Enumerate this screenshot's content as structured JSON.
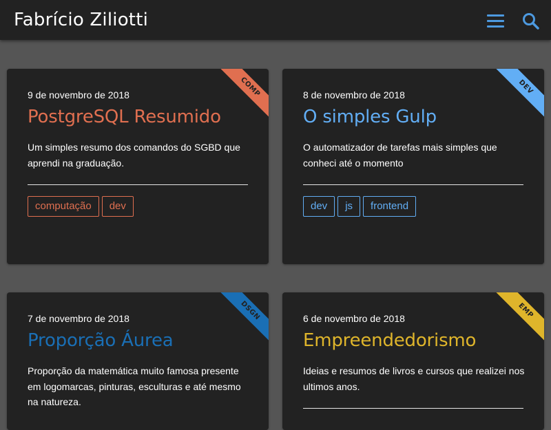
{
  "header": {
    "site_title": "Fabrício Ziliotti",
    "menu_icon": "hamburger-menu-icon",
    "search_icon": "search-icon",
    "accent_color": "#4d9ae0"
  },
  "posts": [
    {
      "ribbon": "COMP",
      "ribbon_color": "#e06f50",
      "accent_color": "#e06f50",
      "date": "9 de novembro de 2018",
      "title": "PostgreSQL Resumido",
      "excerpt": "Um simples resumo dos comandos do SGBD que aprendi na graduação.",
      "tags": [
        "computação",
        "dev"
      ]
    },
    {
      "ribbon": "DEV",
      "ribbon_color": "#62aef5",
      "accent_color": "#62aef5",
      "date": "8 de novembro de 2018",
      "title": "O simples Gulp",
      "excerpt": "O automatizador de tarefas mais simples que conheci até o momento",
      "tags": [
        "dev",
        "js",
        "frontend"
      ]
    },
    {
      "ribbon": "DSGN",
      "ribbon_color": "#1a6fb5",
      "accent_color": "#1a6fb5",
      "date": "7 de novembro de 2018",
      "title": "Proporção Áurea",
      "excerpt": "Proporção da matemática muito famosa presente em logomarcas, pinturas, esculturas e até mesmo na natureza.",
      "tags": []
    },
    {
      "ribbon": "EMP",
      "ribbon_color": "#dfb52b",
      "accent_color": "#dfb52b",
      "date": "6 de novembro de 2018",
      "title": "Empreendedorismo",
      "excerpt": "Ideias e resumos de livros e cursos que realizei nos ultimos anos.",
      "tags": []
    }
  ]
}
